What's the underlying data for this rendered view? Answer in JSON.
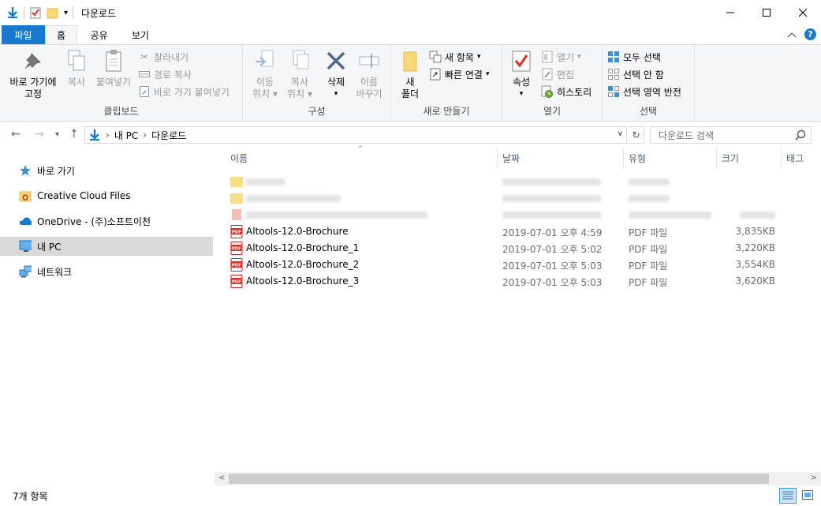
{
  "window": {
    "title": "다운로드",
    "minimize": "—",
    "maximize": "☐",
    "close": "✕"
  },
  "ribbon_tabs": {
    "file": "파일",
    "home": "홈",
    "share": "공유",
    "view": "보기"
  },
  "clipboard": {
    "pin": "바로 가기에\n고정",
    "pin_line1": "바로 가기에",
    "pin_line2": "고정",
    "copy": "복사",
    "paste": "붙여넣기",
    "cut": "잘라내기",
    "copy_path": "경로 복사",
    "paste_shortcut": "바로 가기 붙여넣기",
    "label": "클립보드"
  },
  "organize": {
    "move_to_1": "이동",
    "move_to_2": "위치",
    "copy_to_1": "복사",
    "copy_to_2": "위치",
    "delete": "삭제",
    "rename_1": "이름",
    "rename_2": "바꾸기",
    "label": "구성"
  },
  "new": {
    "folder_1": "새",
    "folder_2": "폴더",
    "new_item": "새 항목",
    "easy_access": "빠른 연결",
    "label": "새로 만들기"
  },
  "open": {
    "properties": "속성",
    "open": "열기",
    "edit": "편집",
    "history": "히스토리",
    "label": "열기"
  },
  "select": {
    "select_all": "모두 선택",
    "select_none": "선택 안 함",
    "invert": "선택 영역 반전",
    "label": "선택"
  },
  "address": {
    "root": "내 PC",
    "current": "다운로드",
    "search_placeholder": "다운로드 검색"
  },
  "sidebar": {
    "items": [
      {
        "label": "바로 가기",
        "icon": "star-icon"
      },
      {
        "label": "Creative Cloud Files",
        "icon": "creative-cloud-folder-icon"
      },
      {
        "label": "OneDrive - (주)소프트이천",
        "icon": "onedrive-cloud-icon"
      },
      {
        "label": "내 PC",
        "icon": "computer-icon"
      },
      {
        "label": "네트워크",
        "icon": "network-icon"
      }
    ]
  },
  "columns": {
    "name": "이름",
    "date": "날짜",
    "type": "유형",
    "size": "크기",
    "tags": "태그"
  },
  "files": [
    {
      "name": "Altools-12.0-Brochure",
      "date": "2019-07-01 오후 4:59",
      "type": "PDF 파일",
      "size": "3,835KB"
    },
    {
      "name": "Altools-12.0-Brochure_1",
      "date": "2019-07-01 오후 5:02",
      "type": "PDF 파일",
      "size": "3,220KB"
    },
    {
      "name": "Altools-12.0-Brochure_2",
      "date": "2019-07-01 오후 5:03",
      "type": "PDF 파일",
      "size": "3,554KB"
    },
    {
      "name": "Altools-12.0-Brochure_3",
      "date": "2019-07-01 오후 5:03",
      "type": "PDF 파일",
      "size": "3,620KB"
    }
  ],
  "status": {
    "count": "7개 항목"
  },
  "colors": {
    "accent": "#1979ca",
    "pdf_red": "#d9302a",
    "folder_yellow": "#f8d775",
    "ribbon_bg": "#f5f6f7"
  }
}
